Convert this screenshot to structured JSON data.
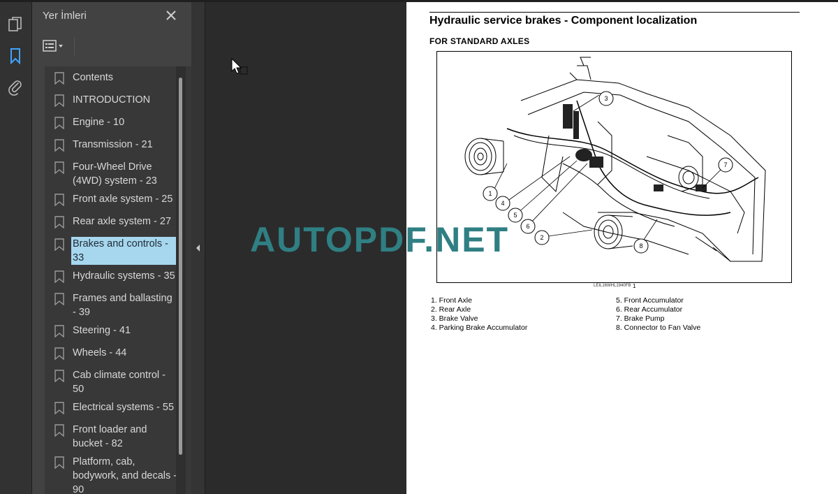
{
  "sidebar": {
    "panel_title": "Yer İmleri",
    "bookmarks": [
      {
        "label": "Contents"
      },
      {
        "label": "INTRODUCTION"
      },
      {
        "label": "Engine - 10"
      },
      {
        "label": "Transmission - 21"
      },
      {
        "label": "Four-Wheel Drive (4WD) system - 23"
      },
      {
        "label": "Front axle system - 25"
      },
      {
        "label": "Rear axle system - 27"
      },
      {
        "label": "Brakes and controls - 33",
        "selected": true
      },
      {
        "label": "Hydraulic systems - 35"
      },
      {
        "label": "Frames and ballasting - 39"
      },
      {
        "label": "Steering - 41"
      },
      {
        "label": "Wheels - 44"
      },
      {
        "label": "Cab climate control - 50"
      },
      {
        "label": "Electrical systems - 55"
      },
      {
        "label": "Front loader and bucket - 82"
      },
      {
        "label": "Platform, cab, bodywork, and decals - 90"
      }
    ]
  },
  "document": {
    "title": "Hydraulic service brakes - Component localization",
    "subtitle": "FOR STANDARD AXLES",
    "figure_ref": "LEIL16WHL1940FB",
    "figure_number": "1",
    "callouts": [
      "1",
      "2",
      "3",
      "4",
      "5",
      "6",
      "7",
      "8"
    ],
    "legend_left": [
      "1.  Front Axle",
      "2.  Rear Axle",
      "3.  Brake Valve",
      "4.  Parking Brake Accumulator"
    ],
    "legend_right": [
      "5.  Front Accumulator",
      "6.  Rear Accumulator",
      "7.  Brake Pump",
      "8.  Connector to Fan Valve"
    ]
  },
  "watermark": "AUTOPDF.NET",
  "colors": {
    "selection": "#a7d7ef",
    "watermark": "#2f7f83",
    "panel": "#424242"
  },
  "icons": [
    "pages-icon",
    "bookmark-icon",
    "attachment-icon",
    "close-icon",
    "options-icon",
    "collapse-arrow-icon"
  ]
}
